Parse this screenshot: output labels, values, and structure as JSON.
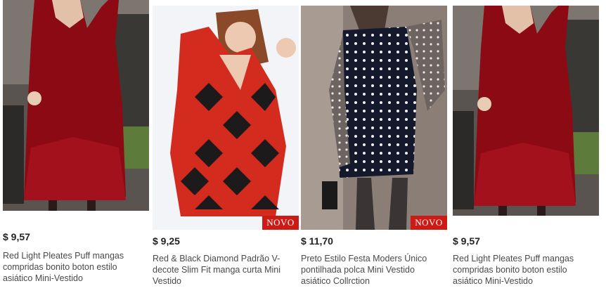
{
  "products": [
    {
      "price": "$ 9,57",
      "title": "Red Light Pleates Puff mangas compridas bonito boton estilo asiático Mini-Vestido",
      "badge": "",
      "image": "red-long-sleeve-dress-photo"
    },
    {
      "price": "$ 9,25",
      "title": "Red & Black Diamond Padrão V-decote Slim Fit manga curta Mini Vestido",
      "badge": "NOVO",
      "image": "checkered-mini-dress-photo"
    },
    {
      "price": "$ 11,70",
      "title": "Preto Estilo Festa Moders Único pontilhada polca Mini Vestido asiático Collrction",
      "badge": "NOVO",
      "image": "polka-dot-dress-photo"
    },
    {
      "price": "$ 9,57",
      "title": "Red Light Pleates Puff mangas compridas bonito boton estilo asiático Mini-Vestido",
      "badge": "",
      "image": "red-long-sleeve-dress-photo"
    }
  ],
  "colors": {
    "badge": "#cc1a16",
    "price": "#222222",
    "title": "#4a4a4a",
    "dress_red": "#a8101a"
  }
}
